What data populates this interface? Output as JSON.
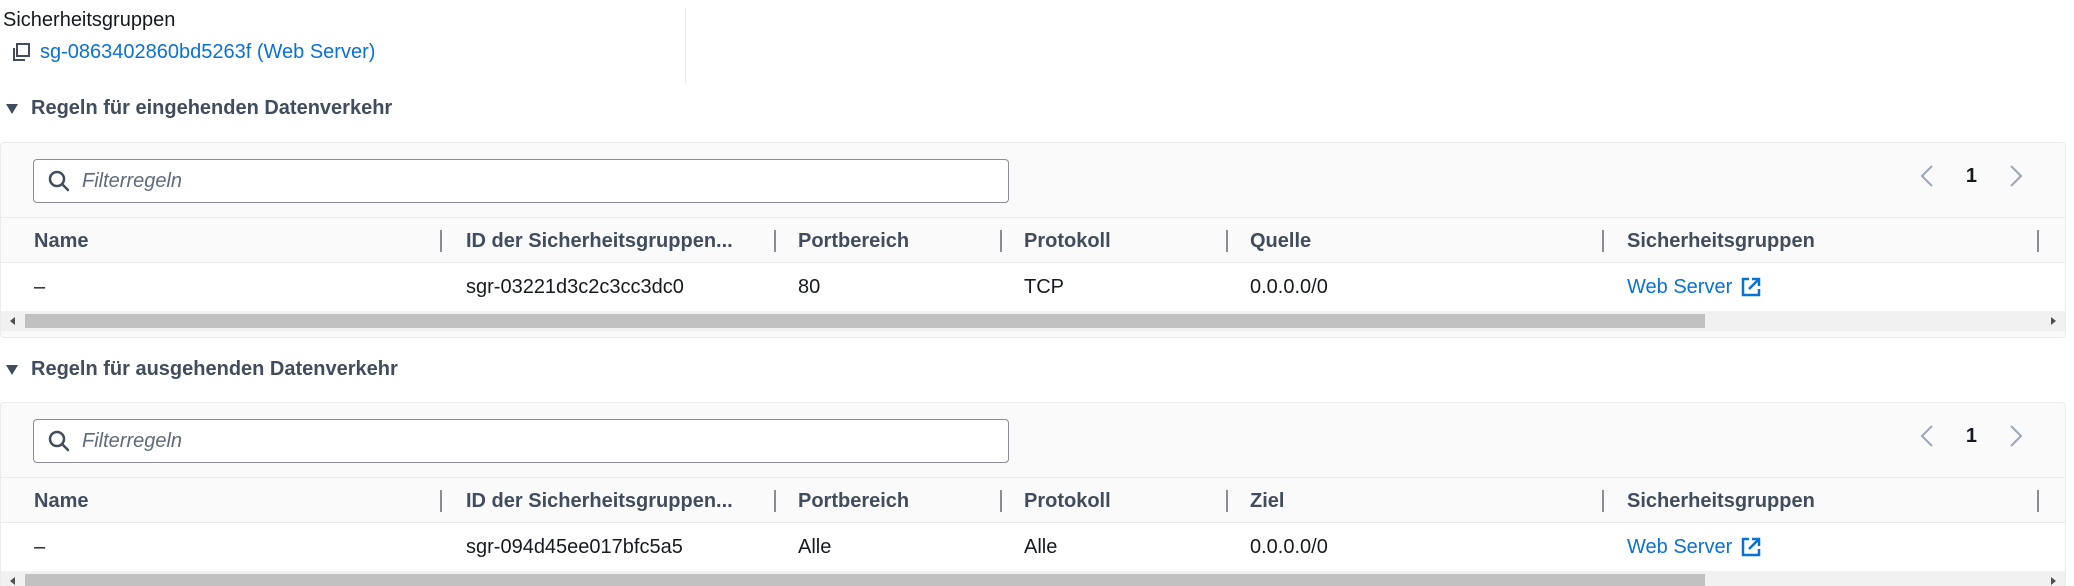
{
  "security_groups": {
    "label": "Sicherheitsgruppen",
    "link_text": "sg-0863402860bd5263f (Web Server)"
  },
  "inbound": {
    "title": "Regeln für eingehenden Datenverkehr",
    "filter_placeholder": "Filterregeln",
    "page": "1",
    "columns": [
      "Name",
      "ID der Sicherheitsgruppen...",
      "Portbereich",
      "Protokoll",
      "Quelle",
      "Sicherheitsgruppen"
    ],
    "row": {
      "name": "–",
      "id": "sgr-03221d3c2c3cc3dc0",
      "port": "80",
      "protocol": "TCP",
      "source": "0.0.0.0/0",
      "groups": "Web Server"
    }
  },
  "outbound": {
    "title": "Regeln für ausgehenden Datenverkehr",
    "filter_placeholder": "Filterregeln",
    "page": "1",
    "columns": [
      "Name",
      "ID der Sicherheitsgruppen...",
      "Portbereich",
      "Protokoll",
      "Ziel",
      "Sicherheitsgruppen"
    ],
    "row": {
      "name": "–",
      "id": "sgr-094d45ee017bfc5a5",
      "port": "Alle",
      "protocol": "Alle",
      "destination": "0.0.0.0/0",
      "groups": "Web Server"
    }
  },
  "colors": {
    "link": "#0972d3",
    "header_text": "#414d5c",
    "border": "#e9ebed"
  }
}
